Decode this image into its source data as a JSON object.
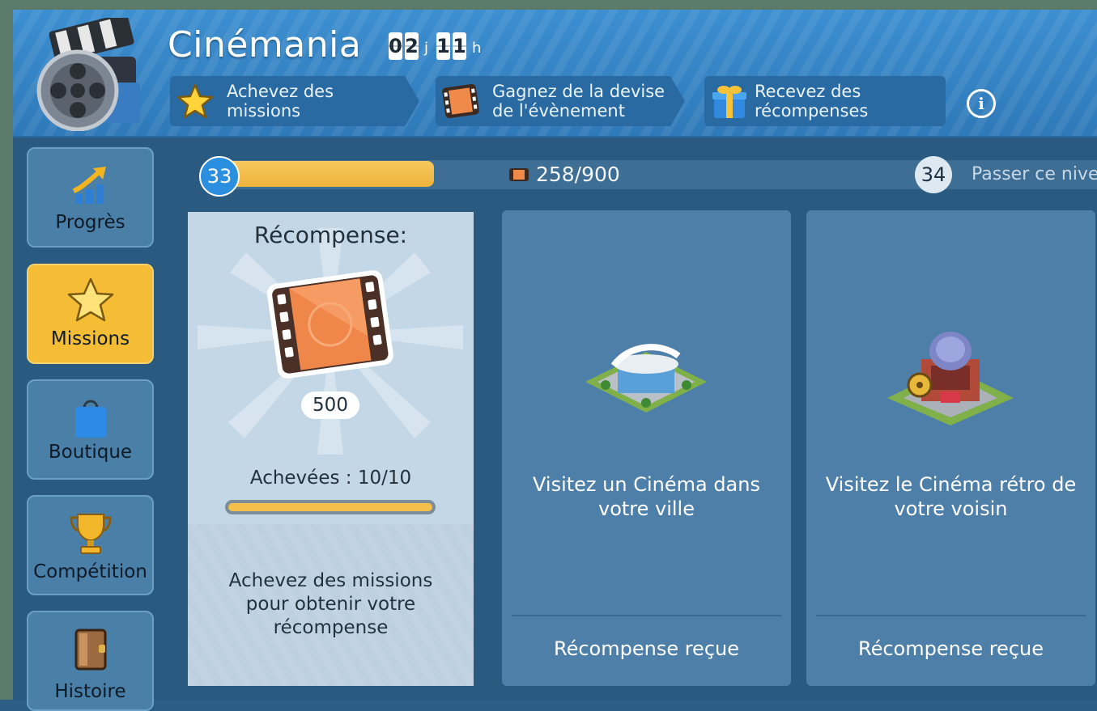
{
  "header": {
    "title": "Cinémania",
    "timer": {
      "days": [
        "0",
        "2"
      ],
      "days_unit": "j",
      "hours": [
        "1",
        "1"
      ],
      "hours_unit": "h"
    },
    "steps": [
      {
        "label_line1": "Achevez des",
        "label_line2": "missions",
        "icon": "star-icon"
      },
      {
        "label_line1": "Gagnez de la devise",
        "label_line2": "de l'évènement",
        "icon": "film-icon"
      },
      {
        "label_line1": "Recevez des",
        "label_line2": "récompenses",
        "icon": "gift-icon"
      }
    ],
    "info": "i"
  },
  "sidebar": {
    "items": [
      {
        "label": "Progrès",
        "icon": "progress-chart-icon"
      },
      {
        "label": "Missions",
        "icon": "star-icon",
        "active": true
      },
      {
        "label": "Boutique",
        "icon": "shopping-bag-icon"
      },
      {
        "label": "Compétition",
        "icon": "trophy-icon"
      },
      {
        "label": "Histoire",
        "icon": "book-icon"
      }
    ]
  },
  "progress": {
    "current_level": "33",
    "next_level": "34",
    "value_text": "258/900",
    "fraction": 0.287,
    "skip_label": "Passer ce nive"
  },
  "reward_card": {
    "title": "Récompense:",
    "amount": "500",
    "completed": "Achevées : 10/10",
    "completed_fraction": 1.0,
    "description_line1": "Achevez des missions",
    "description_line2": "pour obtenir votre",
    "description_line3": "récompense"
  },
  "missions": [
    {
      "line1": "Visitez un Cinéma dans",
      "line2": "votre ville",
      "status": "Récompense reçue",
      "icon": "cinema-building-icon"
    },
    {
      "line1": "Visitez le Cinéma rétro de",
      "line2": "votre voisin",
      "status": "Récompense reçue",
      "icon": "retro-cinema-building-icon"
    }
  ],
  "colors": {
    "accent": "#f4bd35",
    "header": "#3c8fd1",
    "panel": "#2a5a80",
    "card": "#4e7fa8"
  }
}
